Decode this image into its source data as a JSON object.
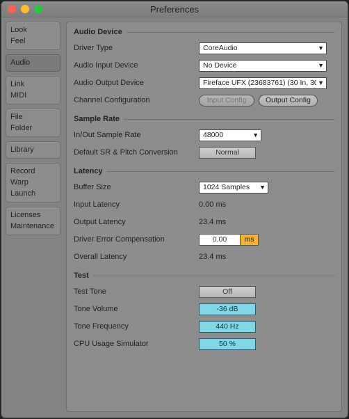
{
  "title": "Preferences",
  "sidebar": {
    "groups": [
      {
        "items": [
          "Look",
          "Feel"
        ],
        "active": false
      },
      {
        "items": [
          "Audio"
        ],
        "active": true
      },
      {
        "items": [
          "Link",
          "MIDI"
        ],
        "active": false
      },
      {
        "items": [
          "File",
          "Folder"
        ],
        "active": false
      },
      {
        "items": [
          "Library"
        ],
        "active": false
      },
      {
        "items": [
          "Record",
          "Warp",
          "Launch"
        ],
        "active": false
      },
      {
        "items": [
          "Licenses",
          "Maintenance"
        ],
        "active": false
      }
    ]
  },
  "sections": {
    "audioDevice": {
      "heading": "Audio Device",
      "driverType": {
        "label": "Driver Type",
        "value": "CoreAudio"
      },
      "inputDevice": {
        "label": "Audio Input Device",
        "value": "No Device"
      },
      "outputDevice": {
        "label": "Audio Output Device",
        "value": "Fireface UFX (23683761) (30 In, 30 O"
      },
      "channelConfig": {
        "label": "Channel Configuration",
        "input": "Input Config",
        "output": "Output Config"
      }
    },
    "sampleRate": {
      "heading": "Sample Rate",
      "rate": {
        "label": "In/Out Sample Rate",
        "value": "48000"
      },
      "pitch": {
        "label": "Default SR & Pitch Conversion",
        "value": "Normal"
      }
    },
    "latency": {
      "heading": "Latency",
      "buffer": {
        "label": "Buffer Size",
        "value": "1024 Samples"
      },
      "inLatency": {
        "label": "Input Latency",
        "value": "0.00 ms"
      },
      "outLatency": {
        "label": "Output Latency",
        "value": "23.4 ms"
      },
      "drvErr": {
        "label": "Driver Error Compensation",
        "value": "0.00",
        "unit": "ms"
      },
      "overall": {
        "label": "Overall Latency",
        "value": "23.4 ms"
      }
    },
    "test": {
      "heading": "Test",
      "tone": {
        "label": "Test Tone",
        "value": "Off"
      },
      "vol": {
        "label": "Tone Volume",
        "value": "-36 dB"
      },
      "freq": {
        "label": "Tone Frequency",
        "value": "440 Hz"
      },
      "cpu": {
        "label": "CPU Usage Simulator",
        "value": "50 %"
      }
    }
  }
}
